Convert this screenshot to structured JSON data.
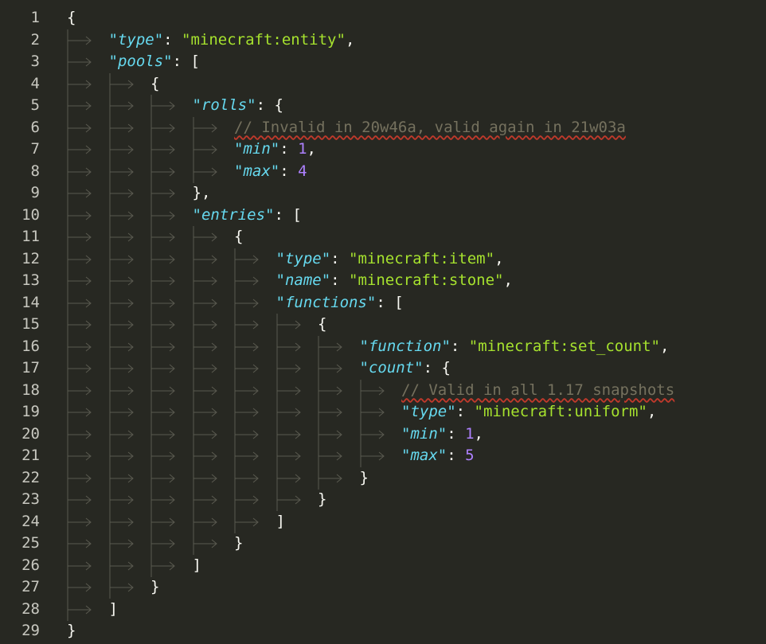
{
  "colors": {
    "background": "#272822",
    "line_number": "#c8c8c0",
    "key": "#66d9ef",
    "string_value": "#a6e22e",
    "number": "#ae81ff",
    "comment": "#75715e",
    "punctuation": "#f8f8f2",
    "indent_guide": "#5a5a50",
    "spellcheck_underline": "#c0392b"
  },
  "lines": [
    {
      "num": "1",
      "indent": 0,
      "tokens": [
        {
          "t": "p",
          "v": "{"
        }
      ]
    },
    {
      "num": "2",
      "indent": 1,
      "tokens": [
        {
          "t": "k",
          "v": "\"type\""
        },
        {
          "t": "p",
          "v": ": "
        },
        {
          "t": "sv",
          "v": "\"minecraft:entity\""
        },
        {
          "t": "p",
          "v": ","
        }
      ]
    },
    {
      "num": "3",
      "indent": 1,
      "tokens": [
        {
          "t": "k",
          "v": "\"pools\""
        },
        {
          "t": "p",
          "v": ": ["
        }
      ]
    },
    {
      "num": "4",
      "indent": 2,
      "tokens": [
        {
          "t": "p",
          "v": "{"
        }
      ]
    },
    {
      "num": "5",
      "indent": 3,
      "tokens": [
        {
          "t": "k",
          "v": "\"rolls\""
        },
        {
          "t": "p",
          "v": ": {"
        }
      ]
    },
    {
      "num": "6",
      "indent": 4,
      "tokens": [
        {
          "t": "c",
          "v": "// Invalid in 20w46a, valid again in 21w03a"
        }
      ]
    },
    {
      "num": "7",
      "indent": 4,
      "tokens": [
        {
          "t": "k",
          "v": "\"min\""
        },
        {
          "t": "p",
          "v": ": "
        },
        {
          "t": "n",
          "v": "1"
        },
        {
          "t": "p",
          "v": ","
        }
      ]
    },
    {
      "num": "8",
      "indent": 4,
      "tokens": [
        {
          "t": "k",
          "v": "\"max\""
        },
        {
          "t": "p",
          "v": ": "
        },
        {
          "t": "n",
          "v": "4"
        }
      ]
    },
    {
      "num": "9",
      "indent": 3,
      "tokens": [
        {
          "t": "p",
          "v": "},"
        }
      ]
    },
    {
      "num": "10",
      "indent": 3,
      "tokens": [
        {
          "t": "k",
          "v": "\"entries\""
        },
        {
          "t": "p",
          "v": ": ["
        }
      ]
    },
    {
      "num": "11",
      "indent": 4,
      "tokens": [
        {
          "t": "p",
          "v": "{"
        }
      ]
    },
    {
      "num": "12",
      "indent": 5,
      "tokens": [
        {
          "t": "k",
          "v": "\"type\""
        },
        {
          "t": "p",
          "v": ": "
        },
        {
          "t": "sv",
          "v": "\"minecraft:item\""
        },
        {
          "t": "p",
          "v": ","
        }
      ]
    },
    {
      "num": "13",
      "indent": 5,
      "tokens": [
        {
          "t": "k",
          "v": "\"name\""
        },
        {
          "t": "p",
          "v": ": "
        },
        {
          "t": "sv",
          "v": "\"minecraft:stone\""
        },
        {
          "t": "p",
          "v": ","
        }
      ]
    },
    {
      "num": "14",
      "indent": 5,
      "tokens": [
        {
          "t": "k",
          "v": "\"functions\""
        },
        {
          "t": "p",
          "v": ": ["
        }
      ]
    },
    {
      "num": "15",
      "indent": 6,
      "tokens": [
        {
          "t": "p",
          "v": "{"
        }
      ]
    },
    {
      "num": "16",
      "indent": 7,
      "tokens": [
        {
          "t": "k",
          "v": "\"function\""
        },
        {
          "t": "p",
          "v": ": "
        },
        {
          "t": "sv",
          "v": "\"minecraft:set_count\""
        },
        {
          "t": "p",
          "v": ","
        }
      ]
    },
    {
      "num": "17",
      "indent": 7,
      "tokens": [
        {
          "t": "k",
          "v": "\"count\""
        },
        {
          "t": "p",
          "v": ": {"
        }
      ]
    },
    {
      "num": "18",
      "indent": 8,
      "tokens": [
        {
          "t": "c",
          "v": "// Valid in all 1.17 snapshots"
        }
      ]
    },
    {
      "num": "19",
      "indent": 8,
      "tokens": [
        {
          "t": "k",
          "v": "\"type\""
        },
        {
          "t": "p",
          "v": ": "
        },
        {
          "t": "sv",
          "v": "\"minecraft:uniform\""
        },
        {
          "t": "p",
          "v": ","
        }
      ]
    },
    {
      "num": "20",
      "indent": 8,
      "tokens": [
        {
          "t": "k",
          "v": "\"min\""
        },
        {
          "t": "p",
          "v": ": "
        },
        {
          "t": "n",
          "v": "1"
        },
        {
          "t": "p",
          "v": ","
        }
      ]
    },
    {
      "num": "21",
      "indent": 8,
      "tokens": [
        {
          "t": "k",
          "v": "\"max\""
        },
        {
          "t": "p",
          "v": ": "
        },
        {
          "t": "n",
          "v": "5"
        }
      ]
    },
    {
      "num": "22",
      "indent": 7,
      "tokens": [
        {
          "t": "p",
          "v": "}"
        }
      ]
    },
    {
      "num": "23",
      "indent": 6,
      "tokens": [
        {
          "t": "p",
          "v": "}"
        }
      ]
    },
    {
      "num": "24",
      "indent": 5,
      "tokens": [
        {
          "t": "p",
          "v": "]"
        }
      ]
    },
    {
      "num": "25",
      "indent": 4,
      "tokens": [
        {
          "t": "p",
          "v": "}"
        }
      ]
    },
    {
      "num": "26",
      "indent": 3,
      "tokens": [
        {
          "t": "p",
          "v": "]"
        }
      ]
    },
    {
      "num": "27",
      "indent": 2,
      "tokens": [
        {
          "t": "p",
          "v": "}"
        }
      ]
    },
    {
      "num": "28",
      "indent": 1,
      "tokens": [
        {
          "t": "p",
          "v": "]"
        }
      ]
    },
    {
      "num": "29",
      "indent": 0,
      "tokens": [
        {
          "t": "p",
          "v": "}"
        }
      ]
    }
  ]
}
